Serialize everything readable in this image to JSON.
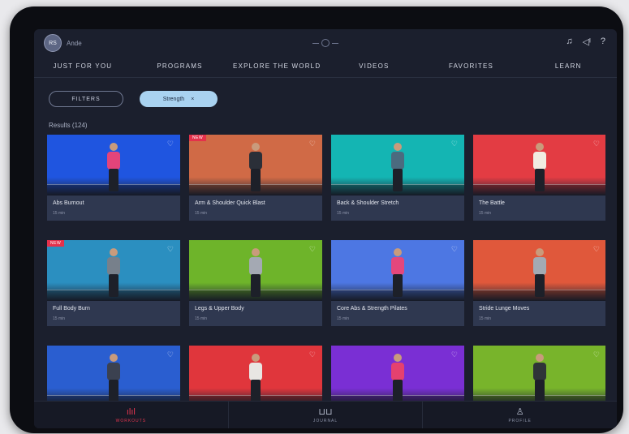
{
  "user": {
    "initials": "RS",
    "name": "Ande"
  },
  "top_icons": {
    "tv": "♫",
    "sound": "◁ᴵ",
    "help": "?"
  },
  "tabs": [
    {
      "label": "JUST FOR YOU",
      "active": false
    },
    {
      "label": "PROGRAMS",
      "active": false
    },
    {
      "label": "EXPLORE THE WORLD",
      "active": false
    },
    {
      "label": "VIDEOS",
      "active": true
    },
    {
      "label": "FAVORITES",
      "active": false
    },
    {
      "label": "LEARN",
      "active": false
    }
  ],
  "filters": {
    "filter_label": "FILTERS",
    "chip_label": "Strength",
    "chip_close": "×"
  },
  "results": "Results (124)",
  "cards": [
    {
      "title": "Abs Burnout",
      "meta": "15 min",
      "bg": "#1f55e0",
      "badge": "",
      "shirt": "#e3447a"
    },
    {
      "title": "Arm & Shoulder Quick Blast",
      "meta": "15 min",
      "bg": "#d06a46",
      "badge": "NEW",
      "shirt": "#2b2f38"
    },
    {
      "title": "Back & Shoulder Stretch",
      "meta": "15 min",
      "bg": "#14b5b3",
      "badge": "",
      "shirt": "#4b6b7f"
    },
    {
      "title": "The Battle",
      "meta": "15 min",
      "bg": "#e33c43",
      "badge": "",
      "shirt": "#f1ece2"
    },
    {
      "title": "Full Body Burn",
      "meta": "15 min",
      "bg": "#2b8fc0",
      "badge": "NEW",
      "shirt": "#77808b"
    },
    {
      "title": "Legs & Upper Body",
      "meta": "15 min",
      "bg": "#6eb42a",
      "badge": "",
      "shirt": "#a4a9b3"
    },
    {
      "title": "Core Abs & Strength Pilates",
      "meta": "15 min",
      "bg": "#4d77e3",
      "badge": "",
      "shirt": "#e4477c"
    },
    {
      "title": "Stride Lunge Moves",
      "meta": "15 min",
      "bg": "#e0583b",
      "badge": "",
      "shirt": "#a3aab3"
    },
    {
      "title": "",
      "meta": "",
      "bg": "#2a5ed0",
      "badge": "",
      "shirt": "#3b4150"
    },
    {
      "title": "",
      "meta": "",
      "bg": "#e0363c",
      "badge": "",
      "shirt": "#e8e6e3"
    },
    {
      "title": "",
      "meta": "",
      "bg": "#7a2fd4",
      "badge": "",
      "shirt": "#e5416f"
    },
    {
      "title": "",
      "meta": "",
      "bg": "#78b42b",
      "badge": "",
      "shirt": "#2f3438"
    }
  ],
  "bottom_nav": [
    {
      "label": "WORKOUTS",
      "icon": "ılıl",
      "active": true
    },
    {
      "label": "JOURNAL",
      "icon": "⊔⊔",
      "active": false
    },
    {
      "label": "PROFILE",
      "icon": "♙",
      "active": false
    }
  ],
  "colors": {
    "accent": "#e4364f",
    "chip": "#a9d2f0",
    "background": "#1b1f2d"
  }
}
